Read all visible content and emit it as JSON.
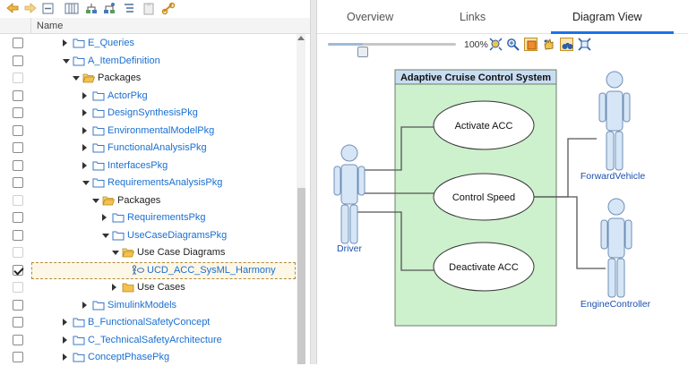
{
  "tree": {
    "column_header": "Name",
    "rows": [
      {
        "label": "E_Queries",
        "type": "folder",
        "toggle": "closed",
        "indent": 0,
        "link": true,
        "checkbox": "normal"
      },
      {
        "label": "A_ItemDefinition",
        "type": "folder",
        "toggle": "open",
        "indent": 0,
        "link": true,
        "checkbox": "normal"
      },
      {
        "label": "Packages",
        "type": "open-folder",
        "toggle": "open",
        "indent": 1,
        "link": false,
        "checkbox": "dim"
      },
      {
        "label": "ActorPkg",
        "type": "folder",
        "toggle": "closed",
        "indent": 2,
        "link": true,
        "checkbox": "normal"
      },
      {
        "label": "DesignSynthesisPkg",
        "type": "folder",
        "toggle": "closed",
        "indent": 2,
        "link": true,
        "checkbox": "normal"
      },
      {
        "label": "EnvironmentalModelPkg",
        "type": "folder",
        "toggle": "closed",
        "indent": 2,
        "link": true,
        "checkbox": "normal"
      },
      {
        "label": "FunctionalAnalysisPkg",
        "type": "folder",
        "toggle": "closed",
        "indent": 2,
        "link": true,
        "checkbox": "normal"
      },
      {
        "label": "InterfacesPkg",
        "type": "folder",
        "toggle": "closed",
        "indent": 2,
        "link": true,
        "checkbox": "normal"
      },
      {
        "label": "RequirementsAnalysisPkg",
        "type": "folder",
        "toggle": "open",
        "indent": 2,
        "link": true,
        "checkbox": "normal"
      },
      {
        "label": "Packages",
        "type": "open-folder",
        "toggle": "open",
        "indent": 3,
        "link": false,
        "checkbox": "dim"
      },
      {
        "label": "RequirementsPkg",
        "type": "folder",
        "toggle": "closed",
        "indent": 4,
        "link": true,
        "checkbox": "normal"
      },
      {
        "label": "UseCaseDiagramsPkg",
        "type": "folder",
        "toggle": "open",
        "indent": 4,
        "link": true,
        "checkbox": "normal"
      },
      {
        "label": "Use Case Diagrams",
        "type": "open-folder",
        "toggle": "open",
        "indent": 5,
        "link": false,
        "checkbox": "dim"
      },
      {
        "label": "UCD_ACC_SysML_Harmony",
        "type": "diagram",
        "toggle": "none",
        "indent": 6,
        "link": true,
        "checkbox": "checked",
        "selected": true
      },
      {
        "label": "Use Cases",
        "type": "folder-yellow",
        "toggle": "closed",
        "indent": 5,
        "link": false,
        "checkbox": "dim"
      },
      {
        "label": "SimulinkModels",
        "type": "folder",
        "toggle": "closed",
        "indent": 2,
        "link": true,
        "checkbox": "normal"
      },
      {
        "label": "B_FunctionalSafetyConcept",
        "type": "folder",
        "toggle": "closed",
        "indent": 0,
        "link": true,
        "checkbox": "normal"
      },
      {
        "label": "C_TechnicalSafetyArchitecture",
        "type": "folder",
        "toggle": "closed",
        "indent": 0,
        "link": true,
        "checkbox": "normal"
      },
      {
        "label": "ConceptPhasePkg",
        "type": "folder",
        "toggle": "closed",
        "indent": 0,
        "link": true,
        "checkbox": "normal"
      }
    ]
  },
  "tabs": {
    "overview": "Overview",
    "links": "Links",
    "diagram_view": "Diagram View",
    "active": "diagram_view"
  },
  "diagram_toolbar": {
    "zoom_text": "100%",
    "zoom_level": 0.25
  },
  "diagram": {
    "system_name": "Adaptive Cruise Control System",
    "use_cases": [
      "Activate ACC",
      "Control Speed",
      "Deactivate ACC"
    ],
    "actors": {
      "driver": "Driver",
      "forward_vehicle": "ForwardVehicle",
      "engine_controller": "EngineController"
    }
  },
  "colors": {
    "link": "#1a6fd1",
    "system_fill": "#cdf0cd",
    "system_header": "#c9ddf2",
    "actor_fill": "#d6e6f7",
    "actor_stroke": "#6f8fb5",
    "actor_label": "#1c4fb0",
    "tab_accent": "#1a73e8"
  }
}
